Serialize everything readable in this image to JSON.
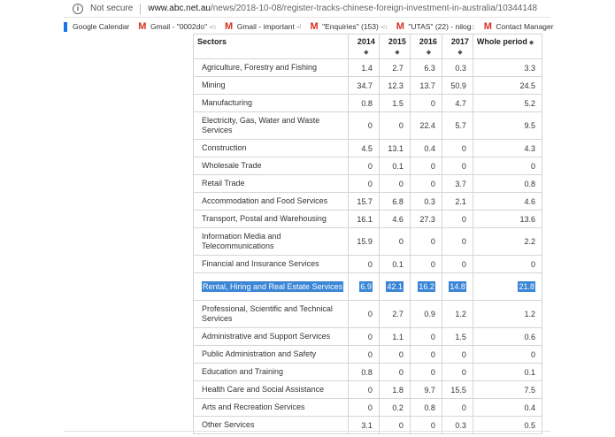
{
  "address_bar": {
    "secure_label": "Not secure",
    "host": "www.abc.net.au",
    "path": "/news/2018-10-08/register-tracks-chinese-foreign-investment-in-australia/10344148"
  },
  "bookmarks": [
    {
      "icon": "calendar-icon",
      "label": "Google Calendar",
      "suffix": ""
    },
    {
      "icon": "gmail-icon",
      "label": "Gmail - \"0002do\" -",
      "suffix": "n"
    },
    {
      "icon": "gmail-icon",
      "label": "Gmail - important -",
      "suffix": "I"
    },
    {
      "icon": "gmail-icon",
      "label": "\"Enquiries\" (153) -",
      "suffix": "n"
    },
    {
      "icon": "gmail-icon",
      "label": "\"UTAS\" (22) - nilog",
      "suffix": "c"
    },
    {
      "icon": "gmail-icon",
      "label": "Contact Manager -",
      "suffix": "n"
    }
  ],
  "table": {
    "headers": [
      "Sectors",
      "2014",
      "2015",
      "2016",
      "2017",
      "Whole period"
    ],
    "sort_glyph": "◆",
    "highlight_color": "#3b86d6",
    "rows": [
      {
        "sector": "Agriculture, Forestry and Fishing",
        "values": [
          "1.4",
          "2.7",
          "6.3",
          "0.3",
          "3.3"
        ]
      },
      {
        "sector": "Mining",
        "values": [
          "34.7",
          "12.3",
          "13.7",
          "50.9",
          "24.5"
        ]
      },
      {
        "sector": "Manufacturing",
        "values": [
          "0.8",
          "1.5",
          "0",
          "4.7",
          "5.2"
        ]
      },
      {
        "sector": "Electricity, Gas, Water and Waste Services",
        "values": [
          "0",
          "0",
          "22.4",
          "5.7",
          "9.5"
        ]
      },
      {
        "sector": "Construction",
        "values": [
          "4.5",
          "13.1",
          "0.4",
          "0",
          "4.3"
        ]
      },
      {
        "sector": "Wholesale Trade",
        "values": [
          "0",
          "0.1",
          "0",
          "0",
          "0"
        ]
      },
      {
        "sector": "Retail Trade",
        "values": [
          "0",
          "0",
          "0",
          "3.7",
          "0.8"
        ]
      },
      {
        "sector": "Accommodation and Food Services",
        "values": [
          "15.7",
          "6.8",
          "0.3",
          "2.1",
          "4.6"
        ]
      },
      {
        "sector": "Transport, Postal and Warehousing",
        "values": [
          "16.1",
          "4.6",
          "27.3",
          "0",
          "13.6"
        ]
      },
      {
        "sector": "Information Media and Telecommunications",
        "values": [
          "15.9",
          "0",
          "0",
          "0",
          "2.2"
        ]
      },
      {
        "sector": "Financial and Insurance Services",
        "values": [
          "0",
          "0.1",
          "0",
          "0",
          "0"
        ]
      },
      {
        "sector": "Rental, Hiring and Real Estate Services",
        "values": [
          "6.9",
          "42.1",
          "16.2",
          "14.8",
          "21.8"
        ],
        "selected": true
      },
      {
        "sector": "Professional, Scientific and Technical Services",
        "values": [
          "0",
          "2.7",
          "0.9",
          "1.2",
          "1.2"
        ]
      },
      {
        "sector": "Administrative and Support Services",
        "values": [
          "0",
          "1.1",
          "0",
          "1.5",
          "0.6"
        ]
      },
      {
        "sector": "Public Administration and Safety",
        "values": [
          "0",
          "0",
          "0",
          "0",
          "0"
        ]
      },
      {
        "sector": "Education and Training",
        "values": [
          "0.8",
          "0",
          "0",
          "0",
          "0.1"
        ]
      },
      {
        "sector": "Health Care and Social Assistance",
        "values": [
          "0",
          "1.8",
          "9.7",
          "15.5",
          "7.5"
        ]
      },
      {
        "sector": "Arts and Recreation Services",
        "values": [
          "0",
          "0.2",
          "0.8",
          "0",
          "0.4"
        ]
      },
      {
        "sector": "Other Services",
        "values": [
          "3.1",
          "0",
          "0",
          "0.3",
          "0.5"
        ]
      }
    ]
  }
}
